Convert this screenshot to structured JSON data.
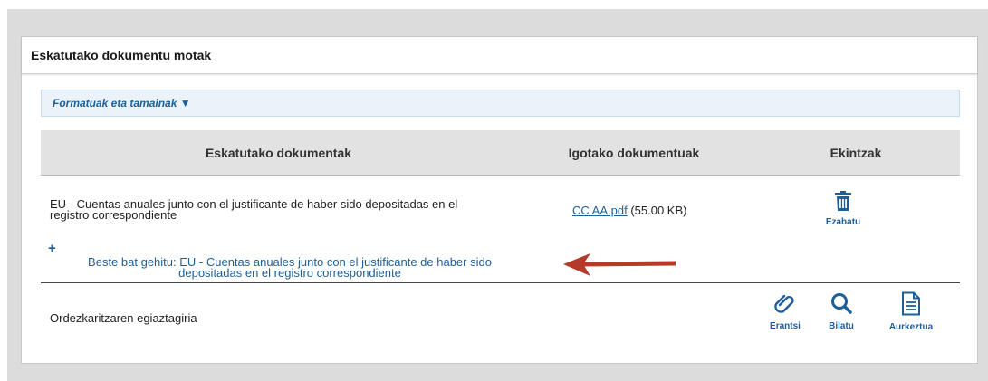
{
  "panel": {
    "title": "Eskatutako dokumentu motak"
  },
  "formats": {
    "label": "Formatuak eta tamainak ▼"
  },
  "table": {
    "headers": [
      "Eskatutako dokumentak",
      "Igotako dokumentuak",
      "Ekintzak"
    ],
    "row1": {
      "doc_line1": "EU - Cuentas anuales junto con el justificante de haber sido depositadas en el",
      "doc_line2": "registro correspondiente",
      "file_link": "CC AA.pdf",
      "file_size": " (55.00 KB)",
      "delete_label": "Ezabatu"
    },
    "add_more": {
      "plus": "+",
      "line1": "Beste bat gehitu: EU - Cuentas anuales junto con el justificante de haber sido",
      "line2": "depositadas en el registro correspondiente"
    },
    "row2": {
      "doc": "Ordezkaritzaren egiaztagiria",
      "attach_label": "Erantsi",
      "search_label": "Bilatu",
      "submit_label": "Aurkeztua"
    }
  },
  "colors": {
    "link": "#1f5f99",
    "arrow": "#b43a2a",
    "header_bg": "#e2e2e2"
  },
  "icons": [
    "trash-icon",
    "paperclip-icon",
    "search-icon",
    "document-icon",
    "arrow-left-icon"
  ]
}
